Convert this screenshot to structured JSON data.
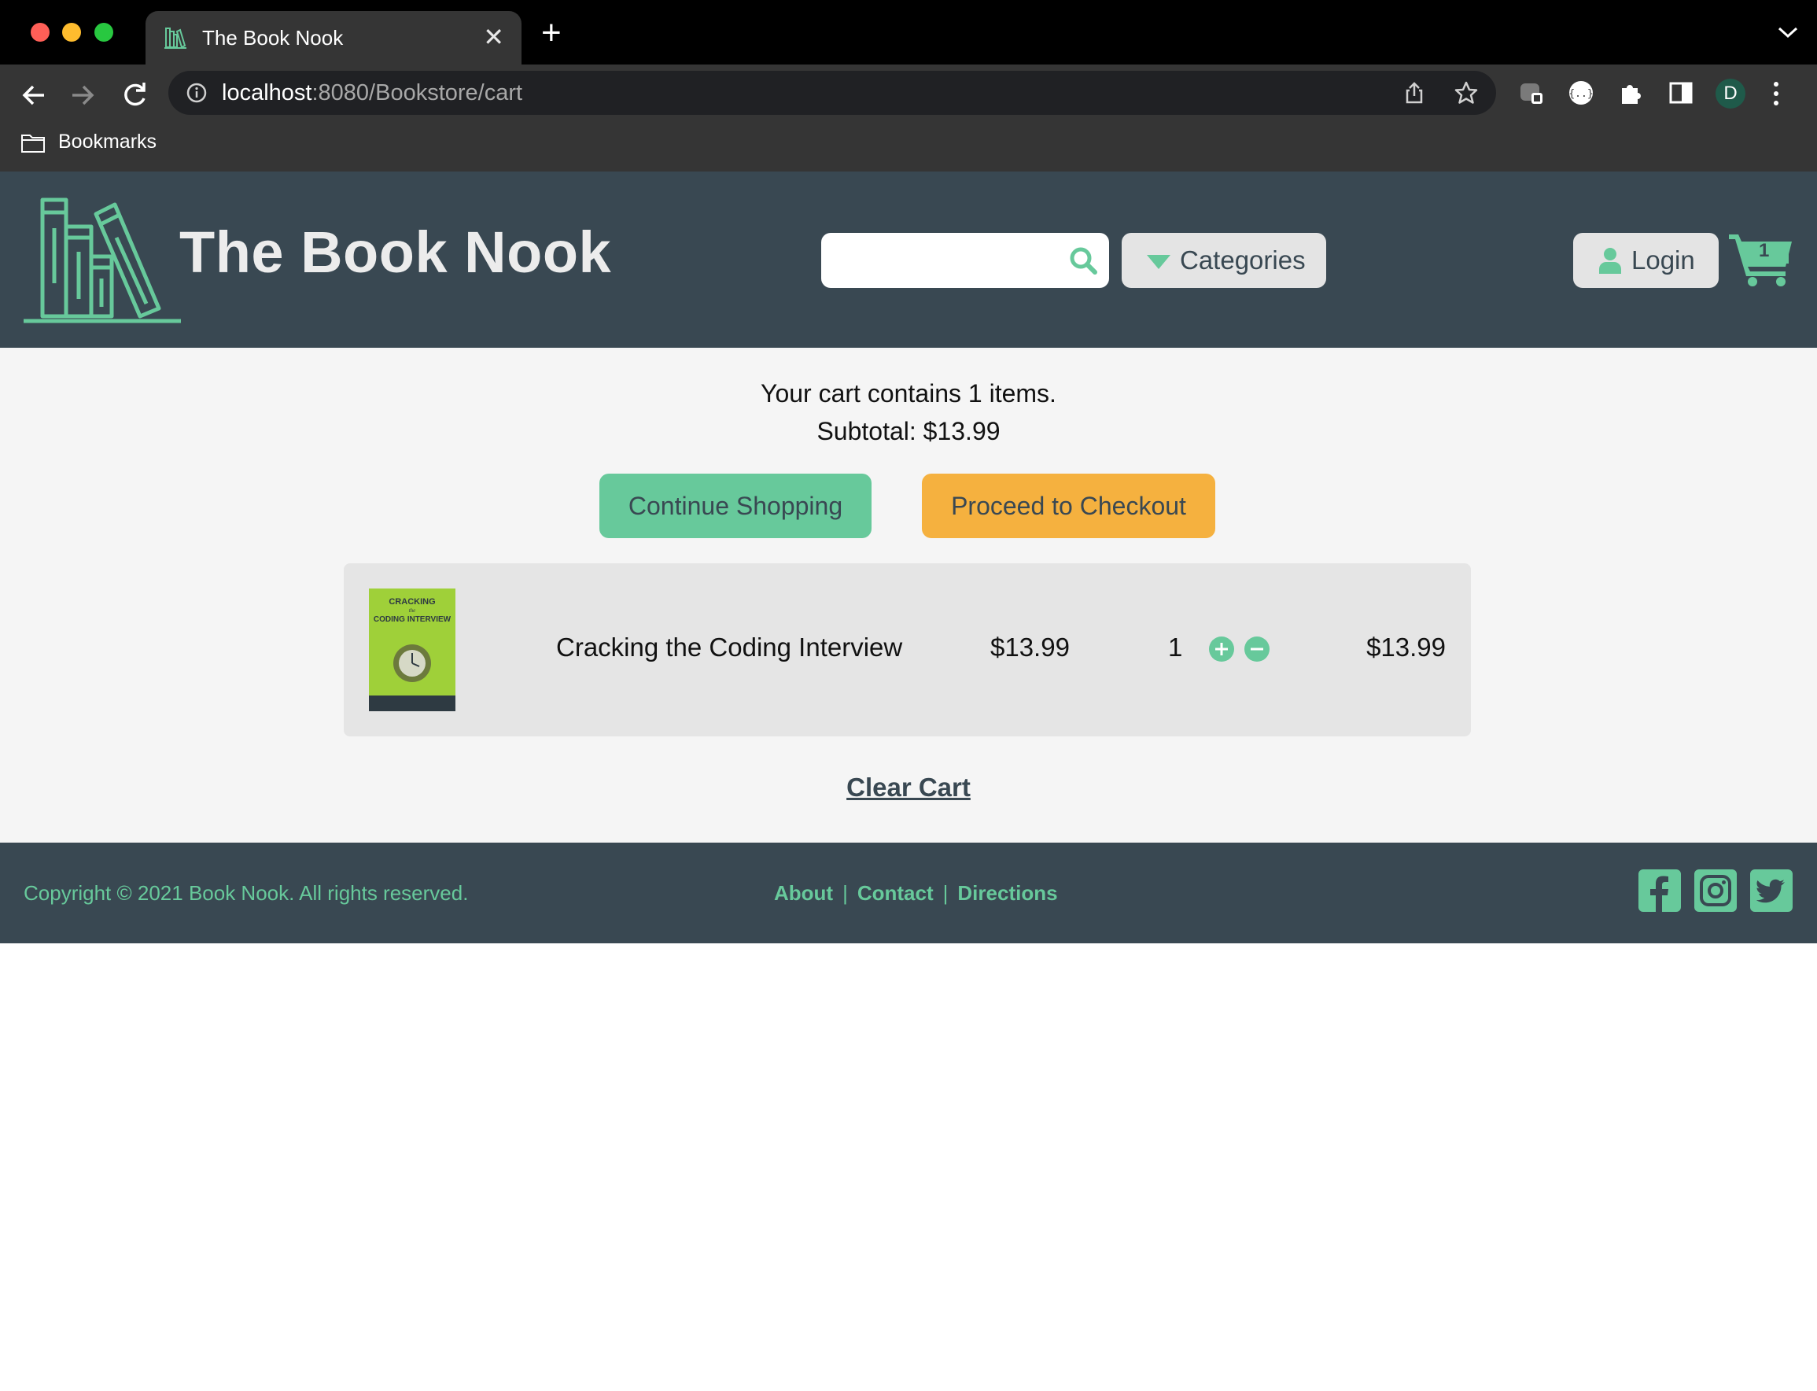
{
  "browser": {
    "tab_title": "The Book Nook",
    "url_host": "localhost",
    "url_rest": ":8080/Bookstore/cart",
    "bookmarks_label": "Bookmarks",
    "profile_initial": "D"
  },
  "header": {
    "brand": "The Book Nook",
    "search_placeholder": "",
    "categories_label": "Categories",
    "login_label": "Login",
    "cart_count": "1"
  },
  "cart": {
    "summary_line": "Your cart contains 1 items.",
    "subtotal_line": "Subtotal: $13.99",
    "continue_label": "Continue Shopping",
    "checkout_label": "Proceed to Checkout",
    "items": [
      {
        "title": "Cracking the Coding Interview",
        "price": "$13.99",
        "quantity": "1",
        "total": "$13.99",
        "cover_text": "CRACKING the CODING INTERVIEW"
      }
    ],
    "clear_label": "Clear Cart"
  },
  "footer": {
    "copyright": "Copyright © 2021 Book Nook. All rights reserved.",
    "links": [
      "About",
      "Contact",
      "Directions"
    ],
    "separator": "|"
  },
  "colors": {
    "header_bg": "#394852",
    "accent_green": "#67c99b",
    "accent_orange": "#f5b13f",
    "page_bg": "#f5f5f5"
  },
  "icons": [
    "search-icon",
    "caret-down-icon",
    "user-icon",
    "cart-icon",
    "plus-icon",
    "minus-icon",
    "facebook-icon",
    "instagram-icon",
    "twitter-icon"
  ]
}
